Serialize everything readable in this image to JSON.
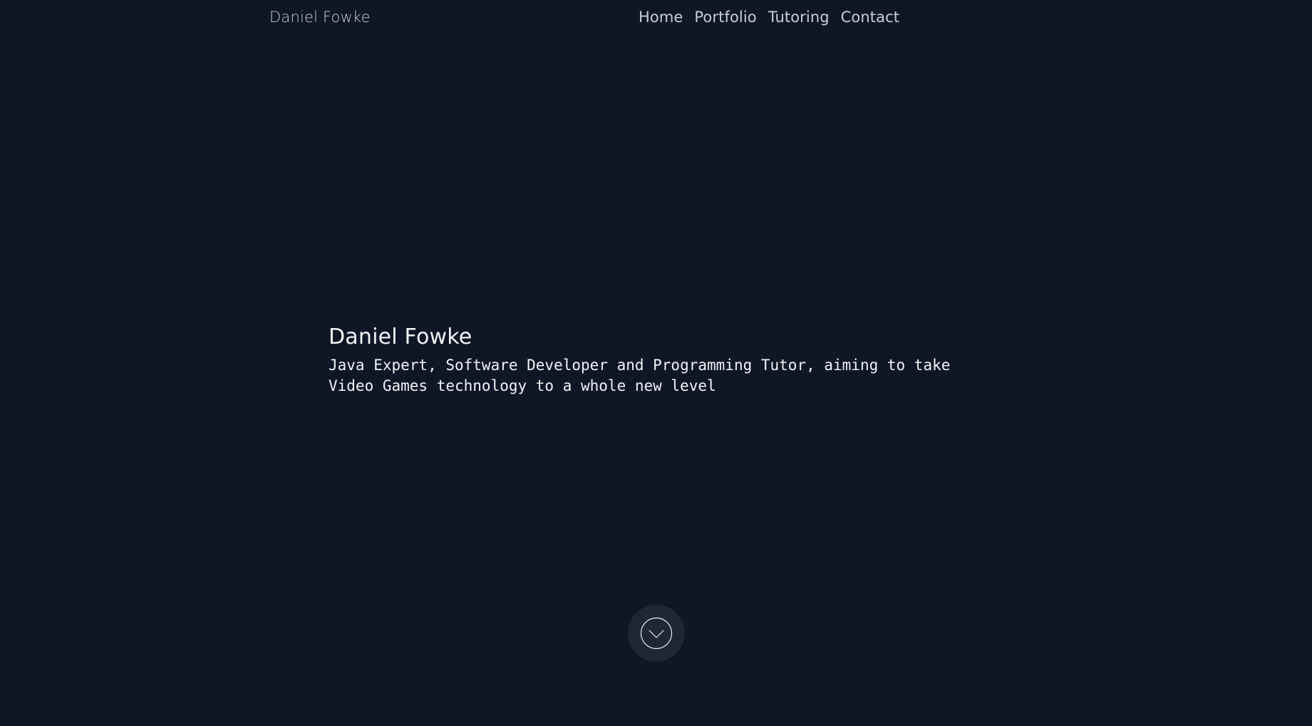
{
  "header": {
    "brand": "Daniel Fowke",
    "nav": [
      {
        "label": "Home"
      },
      {
        "label": "Portfolio"
      },
      {
        "label": "Tutoring"
      },
      {
        "label": "Contact"
      }
    ]
  },
  "hero": {
    "title": "Daniel Fowke",
    "subtitle": "Java Expert, Software Developer and Programming Tutor, aiming to take Video Games technology to a whole new level"
  },
  "scroll_button": {
    "icon": "chevron-down-circle-icon"
  },
  "colors": {
    "background": "#0f1626",
    "nav_text": "#c9cdd6",
    "hero_text": "#f2f3f6",
    "scroll_button_bg": "#1f2634"
  }
}
